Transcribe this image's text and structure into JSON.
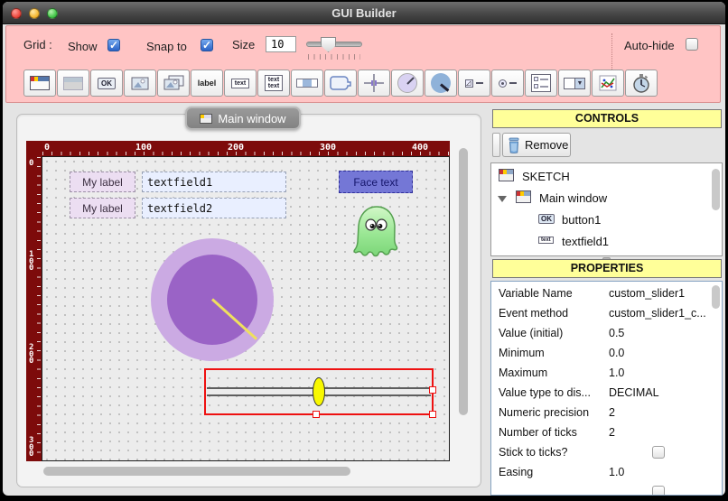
{
  "window": {
    "title": "GUI Builder",
    "traffic_lights": [
      "close",
      "minimize",
      "zoom"
    ]
  },
  "toolbar": {
    "grid_label": "Grid :",
    "show_label": "Show",
    "show_checked": true,
    "snap_label": "Snap to",
    "snap_checked": true,
    "size_label": "Size",
    "size_value": "10",
    "autohide_label": "Auto-hide",
    "autohide_checked": false,
    "icon_text": {
      "ok": "OK",
      "label": "label",
      "text": "text",
      "textarea": "text\ntext"
    },
    "icons": [
      "window-icon",
      "panel-icon",
      "button-icon",
      "image-icon",
      "images-icon",
      "label-icon",
      "textfield-icon",
      "textarea-icon",
      "progressbar-icon",
      "balloon-icon",
      "crosshair-icon",
      "dial-icon",
      "ball-icon",
      "checkbox-slider-icon",
      "radio-slider-icon",
      "checklist-icon",
      "combobox-icon",
      "chart-icon",
      "timer-icon"
    ]
  },
  "tab": {
    "label": "Main window"
  },
  "ruler": {
    "h_labels": [
      "0",
      "100",
      "200",
      "300",
      "400"
    ],
    "v_labels": [
      "0",
      "100",
      "200",
      "300"
    ]
  },
  "canvas": {
    "label1": "My label",
    "label2": "My label",
    "textfield1": "textfield1",
    "textfield2": "textfield2",
    "face_button": "Face text",
    "ghost": "ghost-image",
    "knob": "purple-knob-widget",
    "slider": "custom-slider-widget-selected"
  },
  "controls": {
    "header": "CONTROLS",
    "remove_label": "Remove",
    "tree": [
      {
        "label": "SKETCH",
        "icon": "window",
        "indent": 0
      },
      {
        "label": "Main window",
        "icon": "window",
        "indent": 1,
        "expanded": true
      },
      {
        "label": "button1",
        "icon": "button",
        "indent": 2
      },
      {
        "label": "textfield1",
        "icon": "textfield",
        "indent": 2
      }
    ],
    "icon_text": {
      "button": "OK",
      "textfield": "text"
    }
  },
  "properties": {
    "header": "PROPERTIES",
    "rows": [
      {
        "label": "Variable Name",
        "value": "custom_slider1"
      },
      {
        "label": "Event method",
        "value": "custom_slider1_c..."
      },
      {
        "label": "Value (initial)",
        "value": "0.5"
      },
      {
        "label": "Minimum",
        "value": "0.0"
      },
      {
        "label": "Maximum",
        "value": "1.0"
      },
      {
        "label": "Value type to dis...",
        "value": "DECIMAL"
      },
      {
        "label": "Numeric precision",
        "value": "2"
      },
      {
        "label": "Number of ticks",
        "value": "2"
      },
      {
        "label": "Stick to ticks?",
        "value": "",
        "checkbox": true,
        "checked": false
      },
      {
        "label": "Easing",
        "value": "1.0"
      },
      {
        "label": "",
        "value": "",
        "checkbox": true,
        "checked": false
      }
    ]
  },
  "colors": {
    "accent_pink": "#ffc4c4",
    "ruler_maroon": "#7d0b0b",
    "header_yellow": "#ffff99",
    "selection_red": "#ee1111",
    "knob_outer": "#cbaae3",
    "knob_inner": "#9a63c6",
    "knob_pointer": "#efe05e",
    "slider_yellow": "#f8f800",
    "ghost_green": "#8fdf8a"
  }
}
